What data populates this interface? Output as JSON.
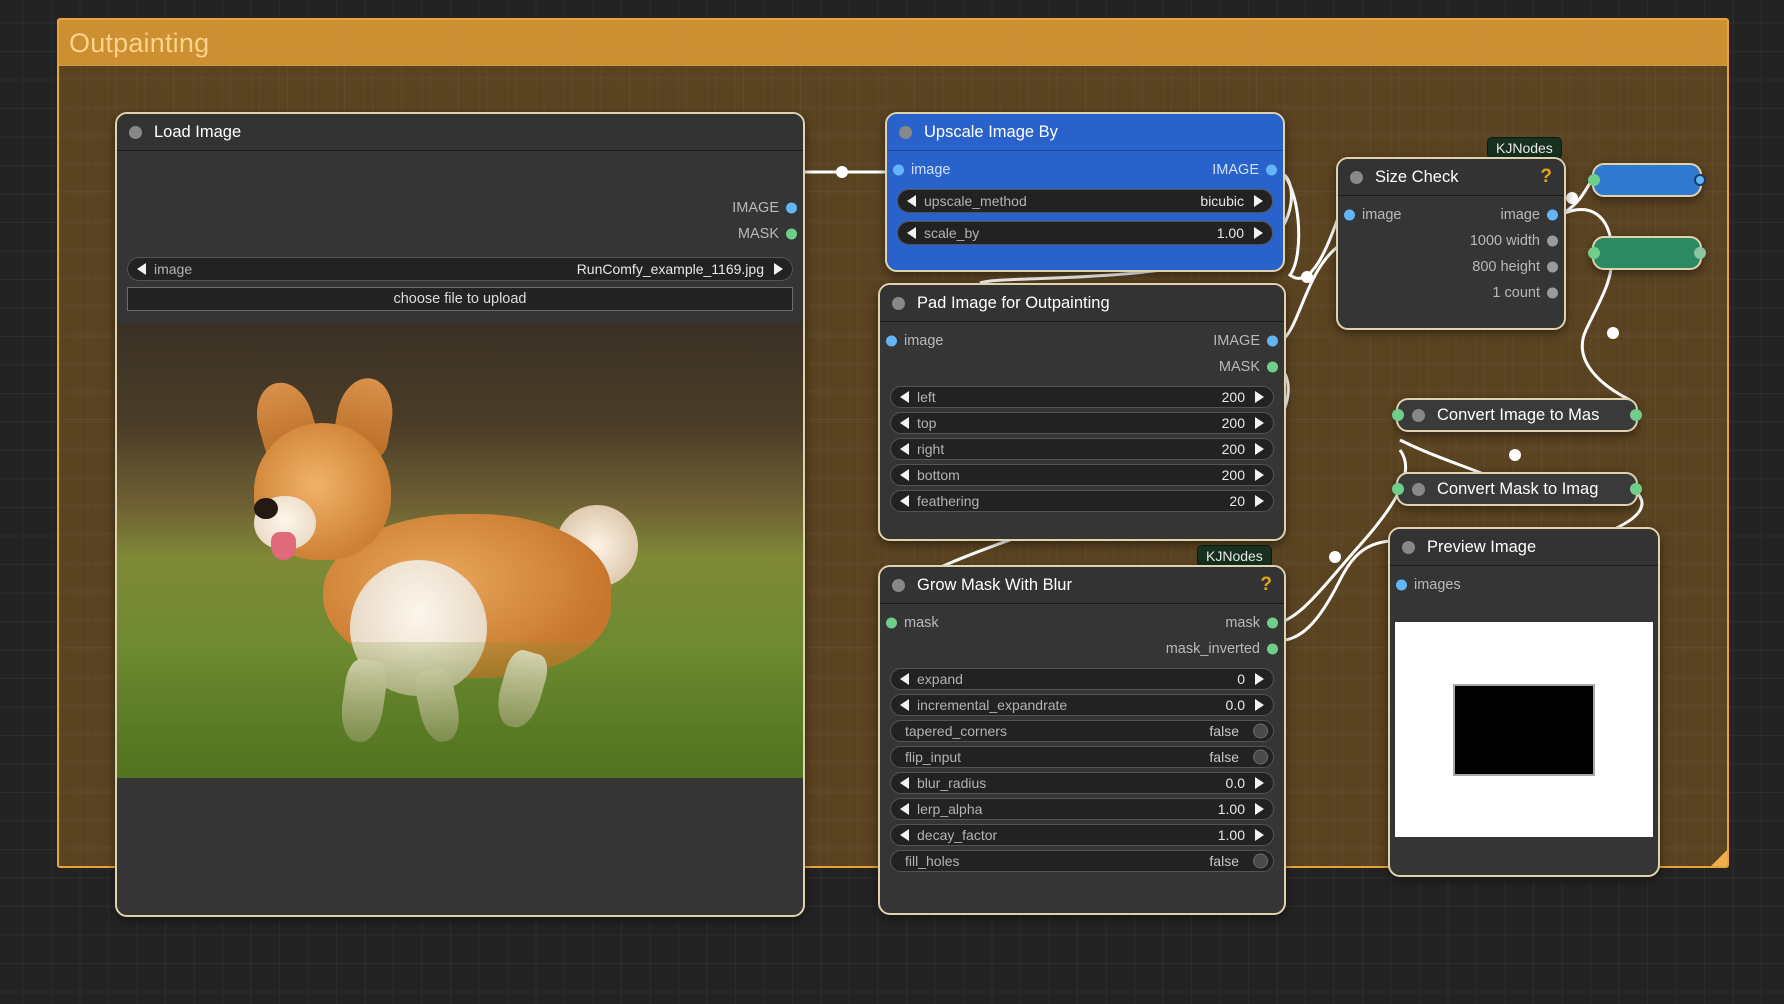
{
  "group": {
    "title": "Outpainting",
    "color": "#d69634",
    "border_color": "#e8a33d"
  },
  "nodes": {
    "load_image": {
      "title": "Load Image",
      "outputs": [
        {
          "label": "IMAGE",
          "type": "image"
        },
        {
          "label": "MASK",
          "type": "mask"
        }
      ],
      "widgets": [
        {
          "name": "image",
          "value": "RunComfy_example_1169.jpg",
          "kind": "combo"
        }
      ],
      "upload_button": "choose file to upload"
    },
    "upscale_image_by": {
      "title": "Upscale Image By",
      "color": "#2a62cb",
      "inputs": [
        {
          "label": "image",
          "type": "image"
        }
      ],
      "outputs": [
        {
          "label": "IMAGE",
          "type": "image"
        }
      ],
      "widgets": [
        {
          "name": "upscale_method",
          "value": "bicubic",
          "kind": "combo"
        },
        {
          "name": "scale_by",
          "value": "1.00",
          "kind": "number"
        }
      ]
    },
    "pad_image_for_outpainting": {
      "title": "Pad Image for Outpainting",
      "inputs": [
        {
          "label": "image",
          "type": "image"
        }
      ],
      "outputs": [
        {
          "label": "IMAGE",
          "type": "image"
        },
        {
          "label": "MASK",
          "type": "mask"
        }
      ],
      "widgets": [
        {
          "name": "left",
          "value": "200",
          "kind": "number"
        },
        {
          "name": "top",
          "value": "200",
          "kind": "number"
        },
        {
          "name": "right",
          "value": "200",
          "kind": "number"
        },
        {
          "name": "bottom",
          "value": "200",
          "kind": "number"
        },
        {
          "name": "feathering",
          "value": "20",
          "kind": "number"
        }
      ]
    },
    "grow_mask_with_blur": {
      "title": "Grow Mask With Blur",
      "badge": "KJNodes",
      "help": "?",
      "inputs": [
        {
          "label": "mask",
          "type": "mask"
        }
      ],
      "outputs": [
        {
          "label": "mask",
          "type": "mask"
        },
        {
          "label": "mask_inverted",
          "type": "mask"
        }
      ],
      "widgets": [
        {
          "name": "expand",
          "value": "0",
          "kind": "number"
        },
        {
          "name": "incremental_expandrate",
          "value": "0.0",
          "kind": "number"
        },
        {
          "name": "tapered_corners",
          "value": "false",
          "kind": "toggle"
        },
        {
          "name": "flip_input",
          "value": "false",
          "kind": "toggle"
        },
        {
          "name": "blur_radius",
          "value": "0.0",
          "kind": "number"
        },
        {
          "name": "lerp_alpha",
          "value": "1.00",
          "kind": "number"
        },
        {
          "name": "decay_factor",
          "value": "1.00",
          "kind": "number"
        },
        {
          "name": "fill_holes",
          "value": "false",
          "kind": "toggle"
        }
      ]
    },
    "size_check": {
      "title": "Size Check",
      "badge": "KJNodes",
      "help": "?",
      "inputs": [
        {
          "label": "image",
          "type": "image"
        }
      ],
      "outputs": [
        {
          "label": "image",
          "type": "image"
        },
        {
          "label": "1000 width",
          "type": "int"
        },
        {
          "label": "800 height",
          "type": "int"
        },
        {
          "label": "1 count",
          "type": "int"
        }
      ]
    },
    "convert_image_to_mask": {
      "title": "Convert Image to Mas"
    },
    "convert_mask_to_image": {
      "title": "Convert Mask to Imag"
    },
    "collapsed_blue": {
      "title": ""
    },
    "collapsed_green": {
      "title": ""
    },
    "preview_image": {
      "title": "Preview Image",
      "inputs": [
        {
          "label": "images",
          "type": "image"
        }
      ]
    }
  }
}
